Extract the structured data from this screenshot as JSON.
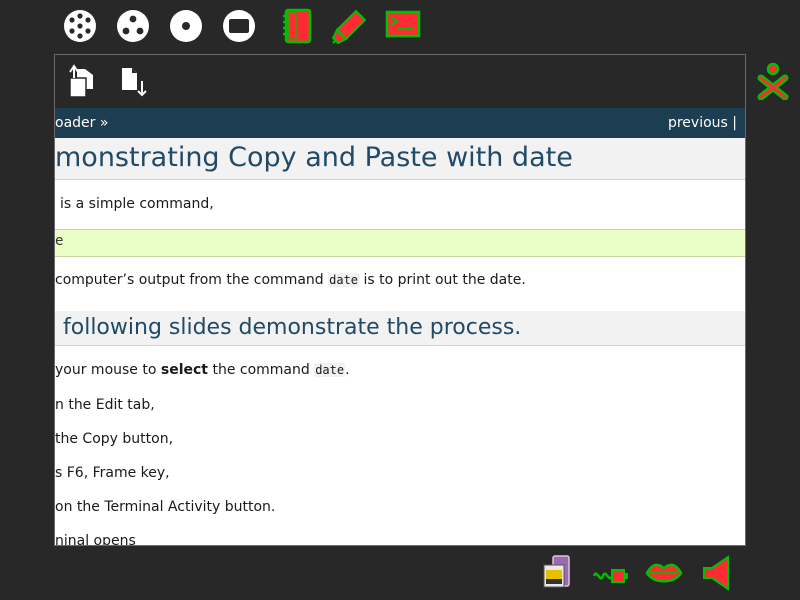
{
  "frame": {
    "top_icons": [
      "neighborhood-icon",
      "group-icon",
      "home-icon",
      "activity-icon",
      "journal-icon",
      "write-activity-icon",
      "terminal-activity-icon"
    ],
    "bottom_icons": [
      "battery-icon",
      "usb-device-icon",
      "speaker-icon",
      "volume-icon"
    ]
  },
  "toolbar": {
    "copy_icon": "copy-icon",
    "paste_icon": "paste-icon"
  },
  "nav": {
    "breadcrumb": "oader »",
    "previous": "previous |"
  },
  "content": {
    "heading": "monstrating Copy and Paste with date",
    "intro": "is a simple command,",
    "code": "e",
    "output_pre": "computer’s output from the command ",
    "output_code": "date",
    "output_post": " is to print out the date.",
    "subheading": "following slides demonstrate the process.",
    "step1_pre": "your mouse to ",
    "step1_bold": "select",
    "step1_mid": " the command ",
    "step1_code": "date",
    "step1_post": ".",
    "step2": "n the Edit tab,",
    "step3": "the Copy button,",
    "step4": "s F6, Frame key,",
    "step5": "on the Terminal Activity button.",
    "step6": "ninal opens"
  },
  "colors": {
    "frame_bg": "#282828",
    "nav_bg": "#1d3d52",
    "heading_color": "#204a67",
    "code_bg": "#eaffc6",
    "accent_green": "#00c000",
    "accent_red": "#ff2b34"
  }
}
